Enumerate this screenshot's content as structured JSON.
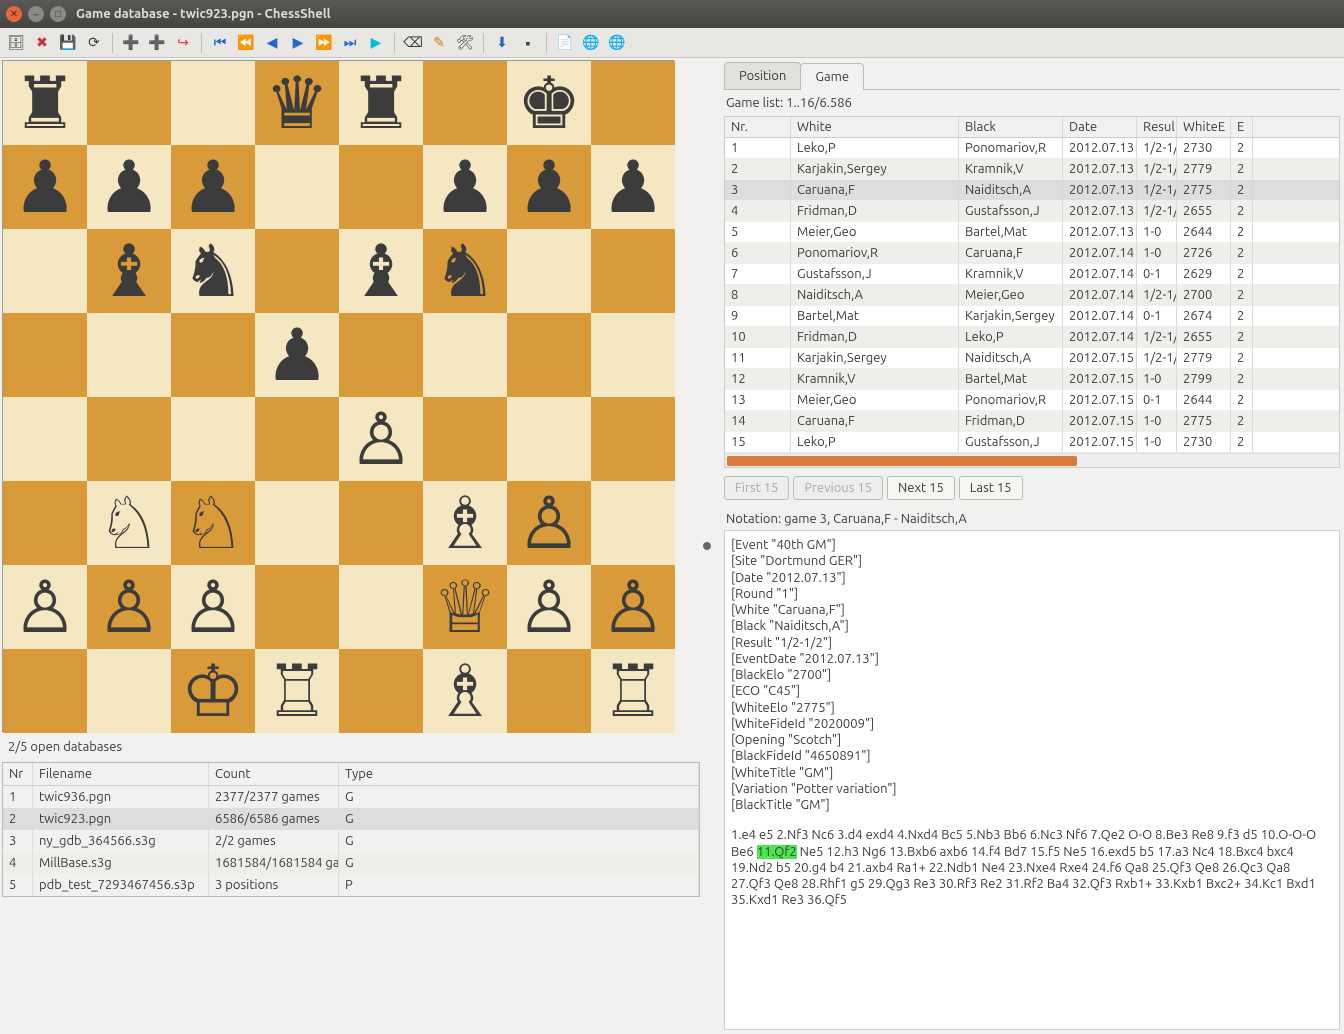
{
  "window": {
    "title": "Game database - twic923.pgn - ChessShell"
  },
  "tabs": {
    "position": "Position",
    "game": "Game"
  },
  "game_list": {
    "label": "Game list: 1..16/6.586"
  },
  "game_table": {
    "headers": [
      "Nr.",
      "White",
      "Black",
      "Date",
      "Resul",
      "WhiteE",
      "E"
    ],
    "rows": [
      {
        "nr": "1",
        "white": "Leko,P",
        "black": "Ponomariov,R",
        "date": "2012.07.13",
        "result": "1/2-1/",
        "we": "2730",
        "be": "2"
      },
      {
        "nr": "2",
        "white": "Karjakin,Sergey",
        "black": "Kramnik,V",
        "date": "2012.07.13",
        "result": "1/2-1/",
        "we": "2779",
        "be": "2"
      },
      {
        "nr": "3",
        "white": "Caruana,F",
        "black": "Naiditsch,A",
        "date": "2012.07.13",
        "result": "1/2-1/",
        "we": "2775",
        "be": "2"
      },
      {
        "nr": "4",
        "white": "Fridman,D",
        "black": "Gustafsson,J",
        "date": "2012.07.13",
        "result": "1/2-1/",
        "we": "2655",
        "be": "2"
      },
      {
        "nr": "5",
        "white": "Meier,Geo",
        "black": "Bartel,Mat",
        "date": "2012.07.13",
        "result": "1-0",
        "we": "2644",
        "be": "2"
      },
      {
        "nr": "6",
        "white": "Ponomariov,R",
        "black": "Caruana,F",
        "date": "2012.07.14",
        "result": "1-0",
        "we": "2726",
        "be": "2"
      },
      {
        "nr": "7",
        "white": "Gustafsson,J",
        "black": "Kramnik,V",
        "date": "2012.07.14",
        "result": "0-1",
        "we": "2629",
        "be": "2"
      },
      {
        "nr": "8",
        "white": "Naiditsch,A",
        "black": "Meier,Geo",
        "date": "2012.07.14",
        "result": "1/2-1/",
        "we": "2700",
        "be": "2"
      },
      {
        "nr": "9",
        "white": "Bartel,Mat",
        "black": "Karjakin,Sergey",
        "date": "2012.07.14",
        "result": "0-1",
        "we": "2674",
        "be": "2"
      },
      {
        "nr": "10",
        "white": "Fridman,D",
        "black": "Leko,P",
        "date": "2012.07.14",
        "result": "1/2-1/",
        "we": "2655",
        "be": "2"
      },
      {
        "nr": "11",
        "white": "Karjakin,Sergey",
        "black": "Naiditsch,A",
        "date": "2012.07.15",
        "result": "1/2-1/",
        "we": "2779",
        "be": "2"
      },
      {
        "nr": "12",
        "white": "Kramnik,V",
        "black": "Bartel,Mat",
        "date": "2012.07.15",
        "result": "1-0",
        "we": "2799",
        "be": "2"
      },
      {
        "nr": "13",
        "white": "Meier,Geo",
        "black": "Ponomariov,R",
        "date": "2012.07.15",
        "result": "0-1",
        "we": "2644",
        "be": "2"
      },
      {
        "nr": "14",
        "white": "Caruana,F",
        "black": "Fridman,D",
        "date": "2012.07.15",
        "result": "1-0",
        "we": "2775",
        "be": "2"
      },
      {
        "nr": "15",
        "white": "Leko,P",
        "black": "Gustafsson,J",
        "date": "2012.07.15",
        "result": "1-0",
        "we": "2730",
        "be": "2"
      }
    ],
    "selected_index": 2
  },
  "pager": {
    "first": "First 15",
    "prev": "Previous 15",
    "next": "Next 15",
    "last": "Last 15"
  },
  "notation_label": "Notation: game 3, Caruana,F - Naiditsch,A",
  "notation": {
    "tags": [
      "[Event \"40th GM\"]",
      "[Site \"Dortmund GER\"]",
      "[Date \"2012.07.13\"]",
      "[Round \"1\"]",
      "[White \"Caruana,F\"]",
      "[Black \"Naiditsch,A\"]",
      "[Result \"1/2-1/2\"]",
      "[EventDate \"2012.07.13\"]",
      "[BlackElo \"2700\"]",
      "[ECO \"C45\"]",
      "[WhiteElo \"2775\"]",
      "[WhiteFideId \"2020009\"]",
      "[Opening \"Scotch\"]",
      "[BlackFideId \"4650891\"]",
      "[WhiteTitle \"GM\"]",
      "[Variation \"Potter variation\"]",
      "[BlackTitle \"GM\"]"
    ],
    "moves_pre": "1.e4 e5 2.Nf3 Nc6 3.d4 exd4 4.Nxd4 Bc5 5.Nb3 Bb6 6.Nc3 Nf6 7.Qe2 O-O 8.Be3 Re8 9.f3 d5 10.O-O-O Be6 ",
    "moves_hl": "11.Qf2",
    "moves_post": " Ne5 12.h3 Ng6 13.Bxb6 axb6 14.f4 Bd7 15.f5 Ne5 16.exd5 b5 17.a3 Nc4 18.Bxc4 bxc4 19.Nd2 b5 20.g4 b4 21.axb4 Ra1+ 22.Ndb1 Ne4 23.Nxe4 Rxe4 24.f6 Qa8 25.Qf3 Qe8 26.Qc3 Qa8 27.Qf3 Qe8 28.Rhf1 g5 29.Qg3 Re3 30.Rf3 Re2 31.Rf2 Ba4 32.Qf3 Rxb1+ 33.Kxb1 Bxc2+ 34.Kc1 Bxd1 35.Kxd1 Re3 36.Qf5"
  },
  "db_status": "2/5 open databases",
  "db_table": {
    "headers": [
      "Nr",
      "Filename",
      "Count",
      "Type"
    ],
    "rows": [
      {
        "nr": "1",
        "file": "twic936.pgn",
        "count": "2377/2377 games",
        "type": "G"
      },
      {
        "nr": "2",
        "file": "twic923.pgn",
        "count": "6586/6586 games",
        "type": "G"
      },
      {
        "nr": "3",
        "file": "ny_gdb_364566.s3g",
        "count": "2/2 games",
        "type": "G"
      },
      {
        "nr": "4",
        "file": "MillBase.s3g",
        "count": "1681584/1681584 ga",
        "type": "G"
      },
      {
        "nr": "5",
        "file": "pdb_test_7293467456.s3p",
        "count": "3 positions",
        "type": "P"
      }
    ],
    "selected_index": 1
  },
  "board": {
    "fen_rows": [
      "r..qr.k.",
      "ppp..ppp",
      ".bn.bn..",
      "...p....",
      "....P...",
      ".NN..BP.",
      "PPP..QPP",
      "..KR.B.R"
    ]
  },
  "piece_glyphs": {
    "K": "♔",
    "Q": "♕",
    "R": "♖",
    "B": "♗",
    "N": "♘",
    "P": "♙",
    "k": "♚",
    "q": "♛",
    "r": "♜",
    "b": "♝",
    "n": "♞",
    "p": "♟"
  }
}
